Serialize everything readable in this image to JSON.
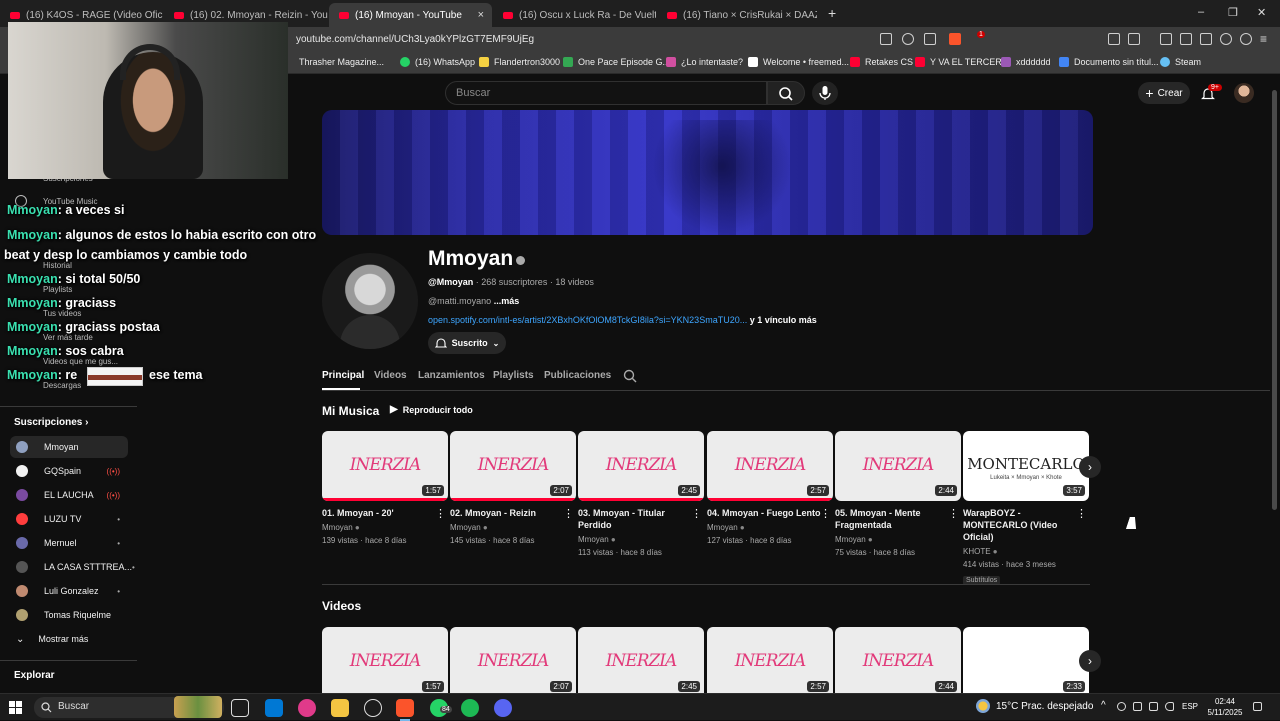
{
  "browser": {
    "tabs": [
      {
        "label": "(16) K4OS - RAGE (Video Oficial) - Yo",
        "active": false
      },
      {
        "label": "(16) 02. Mmoyan - Reizin - YouTube",
        "active": false
      },
      {
        "label": "(16) Mmoyan - YouTube",
        "active": true,
        "close": "×"
      },
      {
        "label": "(16) Oscu x Luck Ra - De Vuelta (Offi",
        "active": false
      },
      {
        "label": "(16) Tiano × CrisRukai × DAAZ - MA",
        "active": false
      }
    ],
    "new_tab": "+",
    "window_controls": {
      "minimize": "–",
      "restore": "❐",
      "close": "✕"
    },
    "url": "youtube.com/channel/UCh3Lya0kYPlzGT7EMF9UjEg",
    "shield_count": "1",
    "bookmarks": [
      {
        "label": "Thrasher Magazine...",
        "color": "#ffffff"
      },
      {
        "label": "(16) WhatsApp",
        "color": "#25d366"
      },
      {
        "label": "Flandertron3000",
        "color": "#f5d142"
      },
      {
        "label": "One Pace Episode G...",
        "color": "#34a853"
      },
      {
        "label": "¿Lo intentaste?",
        "color": "#d14fa0"
      },
      {
        "label": "Welcome • freemed...",
        "color": "#ffffff"
      },
      {
        "label": "Retakes CS",
        "color": "#ff0033"
      },
      {
        "label": "Y VA EL TERCERO",
        "color": "#ff0033"
      },
      {
        "label": "xdddddd",
        "color": "#9b59b6"
      },
      {
        "label": "Documento sin títul...",
        "color": "#4285f4"
      },
      {
        "label": "Steam",
        "color": "#66c0f4"
      }
    ]
  },
  "youtube": {
    "search_placeholder": "Buscar",
    "create_label": "Crear",
    "notif_count": "9+",
    "channel": {
      "name": "Mmoyan",
      "handle": "@Mmoyan",
      "subscribers": "268 suscriptores",
      "videos": "18 videos",
      "meta_separator": " · ",
      "description": "@matti.moyano",
      "more": "...más",
      "link": "open.spotify.com/intl-es/artist/2XBxhOKfOlOM8TckGI8ila?si=YKN23SmaTU20...",
      "more_links": "y 1 vínculo más",
      "subscribed_label": "Suscrito"
    },
    "tabs": [
      "Principal",
      "Videos",
      "Lanzamientos",
      "Playlists",
      "Publicaciones"
    ],
    "sections": {
      "music_title": "Mi Musica",
      "play_all": "Reproducir todo",
      "videos_title": "Videos"
    },
    "thumb_logo": "INERZIA",
    "montecarlo": {
      "big": "MONTECARLO",
      "small": "Lukeita × Mmoyan × Khote"
    },
    "music_cards": [
      {
        "title": "01. Mmoyan - 20'",
        "author": "Mmoyan",
        "stats": "139 vistas · hace 8 días",
        "duration": "1:57",
        "progress": 1.0
      },
      {
        "title": "02. Mmoyan - Reizin",
        "author": "Mmoyan",
        "stats": "145 vistas · hace 8 días",
        "duration": "2:07",
        "progress": 1.0
      },
      {
        "title": "03. Mmoyan - Titular Perdido",
        "author": "Mmoyan",
        "stats": "113 vistas · hace 8 días",
        "duration": "2:45",
        "progress": 1.0
      },
      {
        "title": "04. Mmoyan - Fuego Lento",
        "author": "Mmoyan",
        "stats": "127 vistas · hace 8 días",
        "duration": "2:57",
        "progress": 1.0
      },
      {
        "title": "05. Mmoyan - Mente Fragmentada",
        "author": "Mmoyan",
        "stats": "75 vistas · hace 8 días",
        "duration": "2:44",
        "progress": 0.0
      },
      {
        "title": "WarapBOYZ - MONTECARLO (Video Oficial)",
        "author": "KHOTE",
        "stats": "414 vistas · hace 3 meses",
        "duration": "3:57",
        "progress": 0.0,
        "badge": "Subtítulos"
      }
    ],
    "video_durations": [
      "1:57",
      "2:07",
      "2:45",
      "2:57",
      "2:44",
      "2:33"
    ],
    "sidebar": {
      "ghost_items": [
        "Suscripciones",
        "YouTube Music",
        "Historial",
        "Playlists",
        "Tus videos",
        "Ver más tarde",
        "Videos que me gus...",
        "Descargas"
      ],
      "subs_header": "Suscripciones",
      "subs": [
        {
          "label": "Mmoyan",
          "color": "#8fa0c0",
          "indicator": ""
        },
        {
          "label": "GQSpain",
          "color": "#f2f2f2",
          "indicator": "((•))"
        },
        {
          "label": "EL LAUCHA",
          "color": "#7a4aa0",
          "indicator": "((•))"
        },
        {
          "label": "LUZU TV",
          "color": "#ff3d3d",
          "indicator": "•"
        },
        {
          "label": "Mernuel",
          "color": "#6a6aaa",
          "indicator": "•"
        },
        {
          "label": "LA CASA STTTREA...",
          "color": "#555555",
          "indicator": "•"
        },
        {
          "label": "Luli Gonzalez",
          "color": "#c08a70",
          "indicator": "•"
        },
        {
          "label": "Tomas Riquelme",
          "color": "#b0a070",
          "indicator": ""
        }
      ],
      "show_more": "Mostrar más",
      "explore": "Explorar"
    }
  },
  "stream_overlay": {
    "chat": [
      {
        "user": "Mmoyan",
        "text": ": a veces si"
      },
      {
        "user": "Mmoyan",
        "text": ": algunos de estos lo habia escrito con otro"
      },
      {
        "user": "",
        "text": "beat y desp lo cambiamos y cambie todo"
      },
      {
        "user": "Mmoyan",
        "text": ": si total 50/50"
      },
      {
        "user": "Mmoyan",
        "text": ": graciass"
      },
      {
        "user": "Mmoyan",
        "text": ": graciass postaa"
      },
      {
        "user": "Mmoyan",
        "text": ": sos cabra"
      },
      {
        "user": "Mmoyan",
        "text": ": re"
      },
      {
        "user": "",
        "text": "ese tema"
      }
    ]
  },
  "taskbar": {
    "search": "Buscar",
    "whatsapp_badge": "84",
    "weather": "15°C  Prac. despejado",
    "language": "ESP",
    "time": "02:44",
    "date": "5/11/2025",
    "tray_up": "^"
  }
}
